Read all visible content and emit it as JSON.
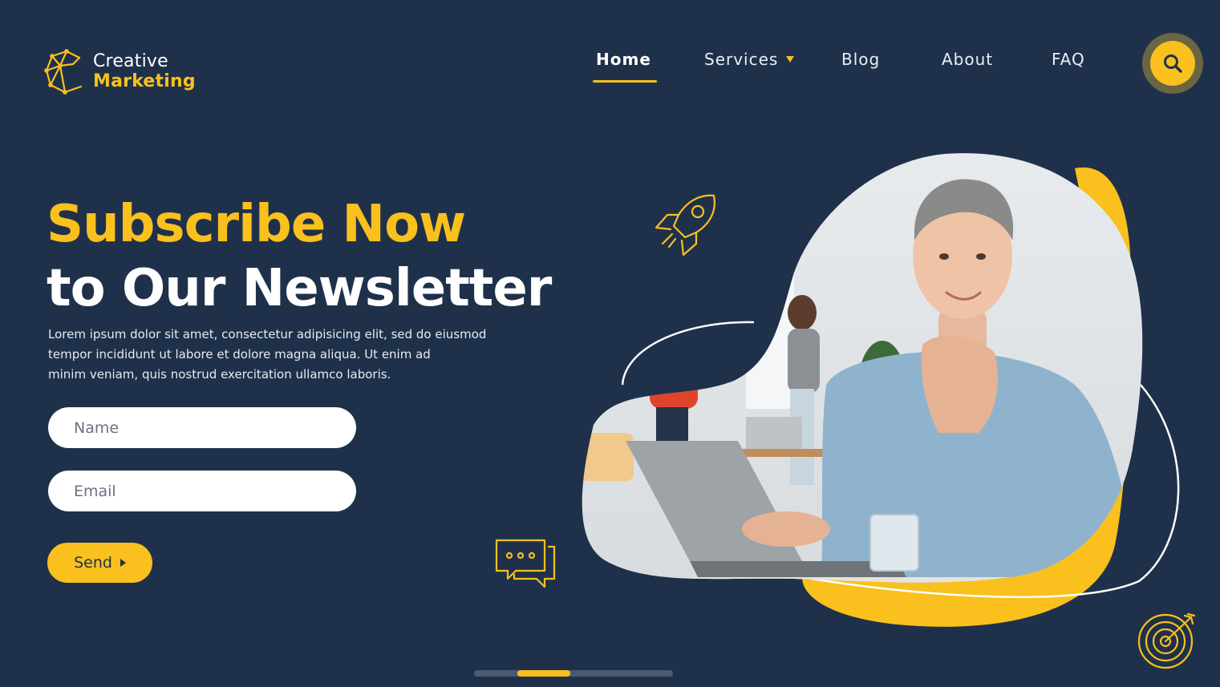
{
  "brand": {
    "line1": "Creative",
    "line2": "Marketing",
    "logo_icon": "c-network-logo-icon"
  },
  "nav": {
    "items": [
      {
        "label": "Home",
        "active": true
      },
      {
        "label": "Services",
        "has_dropdown": true
      },
      {
        "label": "Blog"
      },
      {
        "label": "About"
      },
      {
        "label": "FAQ"
      }
    ],
    "search_icon": "search-icon"
  },
  "hero": {
    "title_line1": "Subscribe Now",
    "title_line2": "to Our Newsletter",
    "description": [
      "Lorem ipsum dolor sit amet, consectetur adipisicing elit, sed do eiusmod",
      "tempor incididunt ut labore et dolore magna aliqua. Ut enim ad",
      "minim veniam, quis nostrud exercitation ullamco laboris."
    ]
  },
  "form": {
    "name_placeholder": "Name",
    "email_placeholder": "Email",
    "send_label": "Send"
  },
  "decor": {
    "icons": [
      "rocket-icon",
      "chat-bubbles-icon",
      "target-arrow-icon"
    ]
  },
  "pagination": {
    "active_index": 1,
    "total": 4
  },
  "colors": {
    "background": "#1f314a",
    "accent": "#f9c01e",
    "text": "#ffffff"
  }
}
